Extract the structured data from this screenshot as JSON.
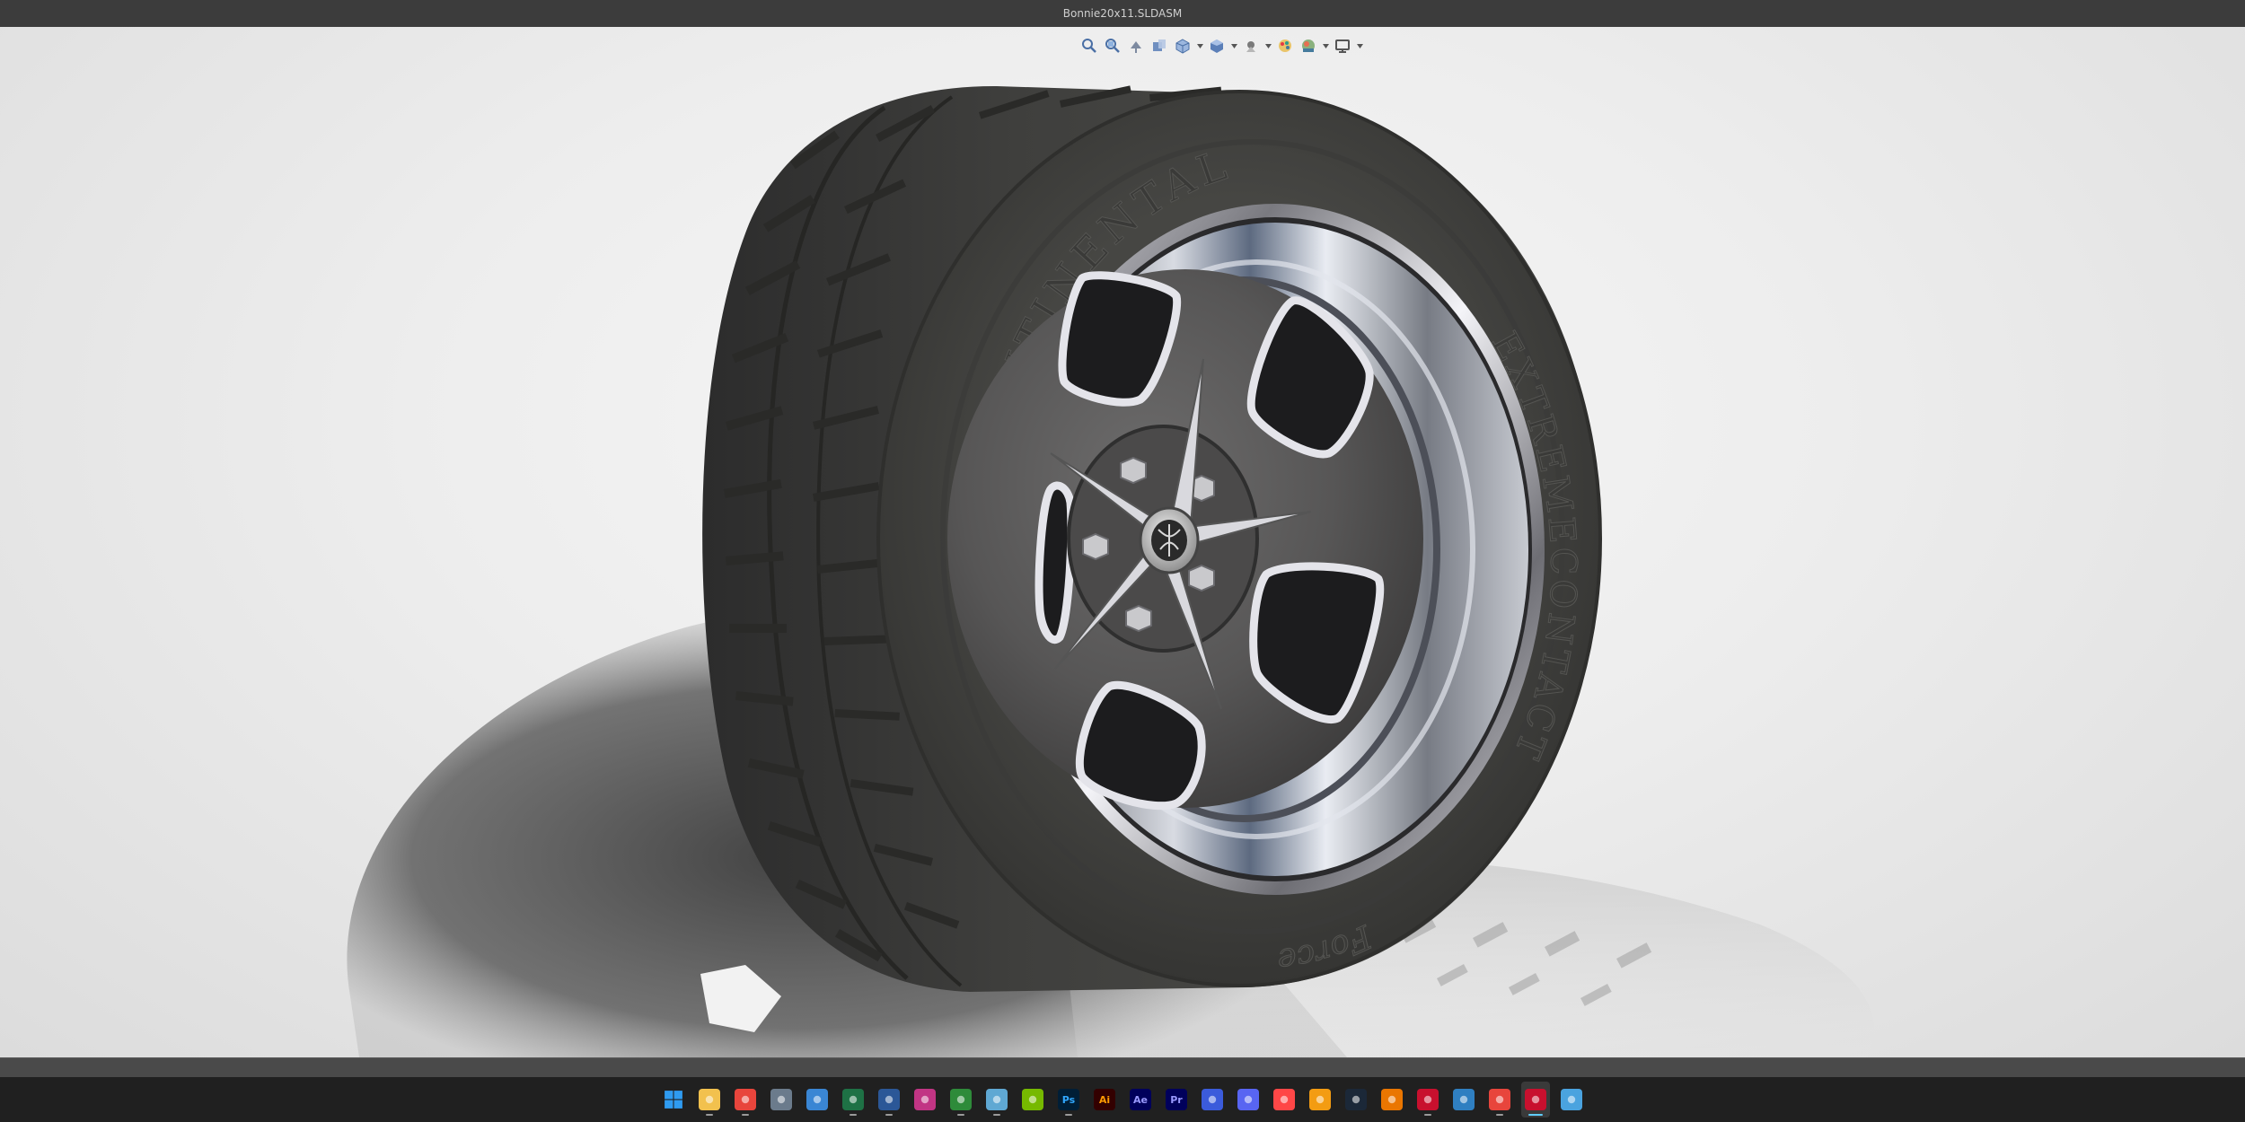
{
  "window": {
    "title": "Bonnie20x11.SLDASM"
  },
  "heads_up_toolbar": [
    {
      "name": "zoom-to-fit-icon",
      "caret": false
    },
    {
      "name": "zoom-to-area-icon",
      "caret": false
    },
    {
      "name": "previous-view-icon",
      "caret": false
    },
    {
      "name": "section-view-icon",
      "caret": false
    },
    {
      "name": "view-orientation-icon",
      "caret": true
    },
    {
      "name": "display-style-icon",
      "caret": true
    },
    {
      "name": "hide-show-items-icon",
      "caret": true
    },
    {
      "name": "edit-appearance-icon",
      "caret": false
    },
    {
      "name": "apply-scene-icon",
      "caret": true
    },
    {
      "name": "view-settings-icon",
      "caret": true
    }
  ],
  "model": {
    "sidewall_text_top": "CONTINENTAL",
    "sidewall_text_side": "EXTREMECONTACT",
    "sidewall_text_bottom": "Force"
  },
  "taskbar": {
    "apps": [
      {
        "name": "start-icon",
        "label": "",
        "color": "#2f9bf0",
        "running": false,
        "active": false
      },
      {
        "name": "file-explorer-icon",
        "label": "",
        "color": "#f2c14e",
        "running": true,
        "active": false
      },
      {
        "name": "chrome-icon",
        "label": "",
        "color": "#e8453c",
        "running": true,
        "active": false
      },
      {
        "name": "calculator-icon",
        "label": "",
        "color": "#6b7b8c",
        "running": false,
        "active": false
      },
      {
        "name": "store-icon",
        "label": "",
        "color": "#3a86d4",
        "running": false,
        "active": false
      },
      {
        "name": "excel-icon",
        "label": "",
        "color": "#1e7145",
        "running": true,
        "active": false
      },
      {
        "name": "word-icon",
        "label": "",
        "color": "#2b5797",
        "running": true,
        "active": false
      },
      {
        "name": "instagram-icon",
        "label": "",
        "color": "#c13584",
        "running": false,
        "active": false
      },
      {
        "name": "xbox-icon",
        "label": "",
        "color": "#2e8b3a",
        "running": true,
        "active": false
      },
      {
        "name": "notepad-icon",
        "label": "",
        "color": "#5fa8d3",
        "running": true,
        "active": false
      },
      {
        "name": "nvidia-icon",
        "label": "",
        "color": "#76b900",
        "running": false,
        "active": false
      },
      {
        "name": "photoshop-icon",
        "label": "Ps",
        "color": "#001e36",
        "running": true,
        "active": false
      },
      {
        "name": "illustrator-icon",
        "label": "Ai",
        "color": "#330000",
        "running": false,
        "active": false
      },
      {
        "name": "after-effects-icon",
        "label": "Ae",
        "color": "#00005b",
        "running": false,
        "active": false
      },
      {
        "name": "premiere-icon",
        "label": "Pr",
        "color": "#00005b",
        "running": false,
        "active": false
      },
      {
        "name": "tasks-icon",
        "label": "",
        "color": "#3b5bdb",
        "running": false,
        "active": false
      },
      {
        "name": "discord-icon",
        "label": "",
        "color": "#5865f2",
        "running": false,
        "active": false
      },
      {
        "name": "ea-icon",
        "label": "",
        "color": "#ff4747",
        "running": false,
        "active": false
      },
      {
        "name": "fusion-icon",
        "label": "",
        "color": "#f39c12",
        "running": false,
        "active": false
      },
      {
        "name": "steam-icon",
        "label": "",
        "color": "#1b2838",
        "running": false,
        "active": false
      },
      {
        "name": "blender-icon",
        "label": "",
        "color": "#ea7600",
        "running": false,
        "active": false
      },
      {
        "name": "solidworks-icon",
        "label": "",
        "color": "#c8102e",
        "running": true,
        "active": false
      },
      {
        "name": "sketchup-icon",
        "label": "",
        "color": "#2f7fc1",
        "running": false,
        "active": false
      },
      {
        "name": "chrome-icon",
        "label": "",
        "color": "#e8453c",
        "running": true,
        "active": false
      },
      {
        "name": "solidworks-icon",
        "label": "",
        "color": "#c8102e",
        "running": true,
        "active": true
      },
      {
        "name": "notes-icon",
        "label": "",
        "color": "#4aa3df",
        "running": false,
        "active": false
      }
    ]
  }
}
